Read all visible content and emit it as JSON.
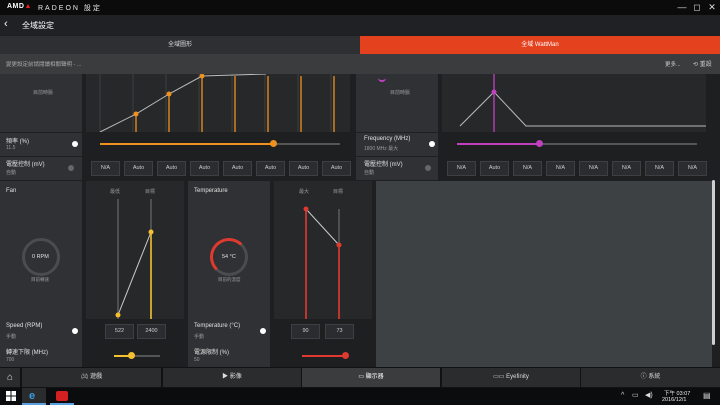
{
  "window": {
    "logo_prefix": "AMD",
    "logo_mark": "▲",
    "app_title": "RADEON 設定",
    "minimize_glyph": "—",
    "restore_glyph": "◻",
    "close_glyph": "✕"
  },
  "nav": {
    "back_glyph": "‹",
    "title": "全域設定"
  },
  "tabs": [
    {
      "label": "全域圖形",
      "active": false
    },
    {
      "label": "全域 WattMan",
      "active": true
    }
  ],
  "info": {
    "text": "變更設定前請閱讀相關聲明 - ...",
    "more": "更多...",
    "reset": "重設"
  },
  "gpu_clock": {
    "graph_center_label": "目前時脈",
    "freq_label": "頻率 (%)",
    "freq_value": "11.5",
    "voltage_label": "電壓控制 (mV)",
    "voltage_mode": "自動",
    "state_values": [
      "N/A",
      "Auto",
      "Auto",
      "Auto",
      "Auto",
      "Auto",
      "Auto",
      "Auto"
    ],
    "slider_fraction": 0.72
  },
  "memory": {
    "graph_center_label": "目前時脈",
    "freq_label": "Frequency (MHz)",
    "freq_value": "1800 MHz 最大",
    "voltage_label": "電壓控制 (mV)",
    "voltage_mode": "自動",
    "state_values": [
      "N/A",
      "Auto",
      "N/A",
      "N/A",
      "N/A",
      "N/A",
      "N/A",
      "N/A"
    ],
    "slider_fraction": 0.34
  },
  "fan": {
    "title": "Fan",
    "col_min": "最低",
    "col_target": "目標",
    "rpm": "0 RPM",
    "rpm_caption": "目前轉速",
    "speed_label": "Speed (RPM)",
    "speed_mode": "手動",
    "min_label": "轉速下限 (MHz)",
    "min_value": "700",
    "value_min": "522",
    "value_target": "2400"
  },
  "temperature": {
    "title": "Temperature",
    "col_max": "最大",
    "col_target": "目標",
    "reading": "54 °C",
    "reading_caption": "目前的溫度",
    "temp_label": "Temperature (°C)",
    "temp_mode": "手動",
    "power_label": "電源限制 (%)",
    "power_value": "50",
    "value_max": "90",
    "value_target": "73"
  },
  "bottom_tabs": [
    {
      "label": "遊戲",
      "icon": "gamepad-icon"
    },
    {
      "label": "影像",
      "icon": "play-icon"
    },
    {
      "label": "顯示器",
      "icon": "monitor-icon"
    },
    {
      "label": "Eyefinity",
      "icon": "eyefinity-icon"
    },
    {
      "label": "系統",
      "icon": "info-icon"
    }
  ],
  "taskbar": {
    "time": "下午 03:07",
    "date": "2016/12/1"
  },
  "colors": {
    "accent": "#e4411f",
    "orange": "#f0901e",
    "magenta": "#c040c0",
    "yellow": "#f5c030",
    "red": "#e03a30"
  }
}
